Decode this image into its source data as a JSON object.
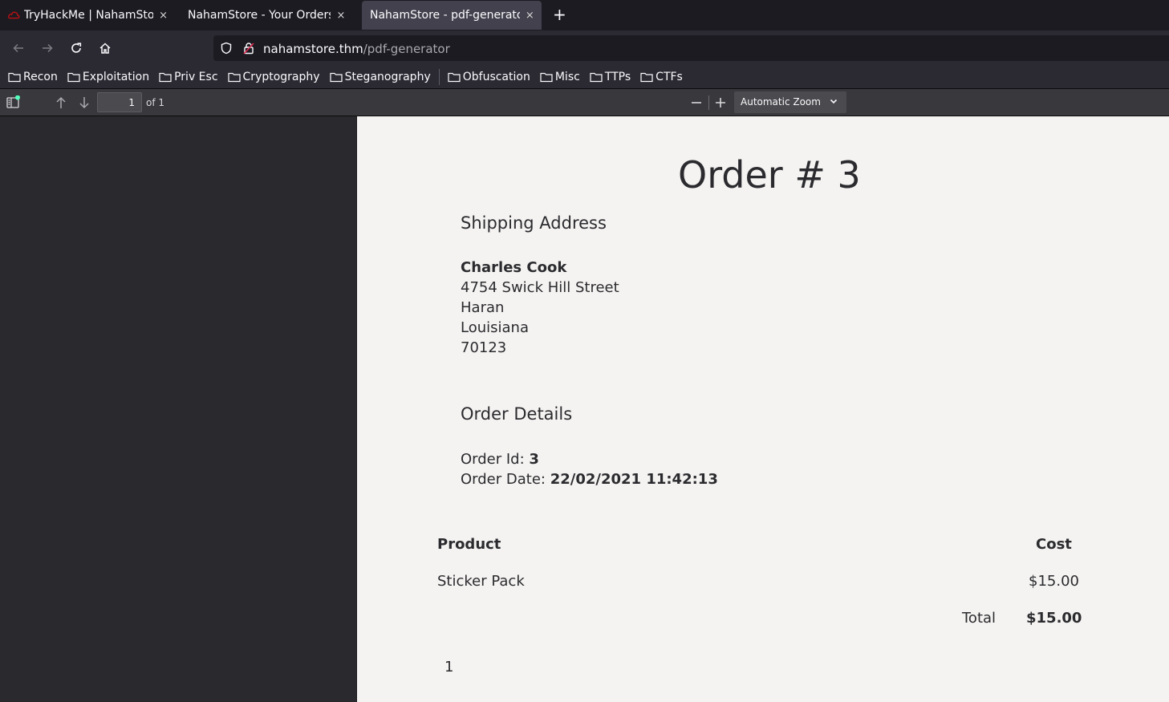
{
  "tabs": [
    {
      "title": "TryHackMe | NahamStore",
      "active": false
    },
    {
      "title": "NahamStore - Your Orders",
      "active": false
    },
    {
      "title": "NahamStore - pdf-generator",
      "active": true
    }
  ],
  "new_tab_label": "+",
  "close_glyph": "×",
  "url": {
    "host": "nahamstore.thm",
    "path": "/pdf-generator"
  },
  "bookmarks": [
    "Recon",
    "Exploitation",
    "Priv Esc",
    "Cryptography",
    "Steganography",
    "Obfuscation",
    "Misc",
    "TTPs",
    "CTFs"
  ],
  "pdf_toolbar": {
    "page_number": "1",
    "page_count": "of 1",
    "zoom": "Automatic Zoom"
  },
  "document": {
    "title": "Order # 3",
    "shipping_heading": "Shipping Address",
    "customer_name": "Charles Cook",
    "street": "4754 Swick Hill Street",
    "city": "Haran",
    "state": "Louisiana",
    "zip": "70123",
    "details_heading": "Order Details",
    "order_id_label": "Order Id:",
    "order_id": "3",
    "order_date_label": "Order Date:",
    "order_date": "22/02/2021 11:42:13",
    "table": {
      "headers": [
        "Product",
        "Cost"
      ],
      "rows": [
        {
          "product": "Sticker Pack",
          "cost": "$15.00"
        }
      ],
      "total_label": "Total",
      "total": "$15.00"
    },
    "page_footer": "1"
  },
  "colors": {
    "tab_bg": "#1c1b22",
    "active_tab": "#42414d",
    "toolbar": "#2b2a33",
    "pdf_toolbar": "#38383d",
    "page_bg": "#f4f3f1",
    "accent_dot": "#54ffbd"
  }
}
